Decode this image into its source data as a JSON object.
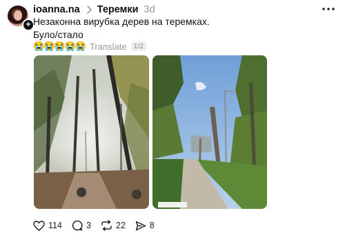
{
  "post": {
    "username": "ioanna.na",
    "topic": "Теремки",
    "time": "3d",
    "text_line1": "Незаконна вирубка дерев на теремках.",
    "text_line2": "Було/стало",
    "emojis": "😭😭😭😭😭",
    "translate_label": "Translate",
    "page_indicator": "1/2"
  },
  "actions": {
    "likes": "114",
    "comments": "3",
    "reposts": "22",
    "shares": "8"
  },
  "icons": {
    "chevron": "chevron-right-icon",
    "more": "more-horizontal-icon",
    "like": "heart-icon",
    "comment": "comment-bubble-icon",
    "repost": "repost-icon",
    "share": "send-icon"
  }
}
